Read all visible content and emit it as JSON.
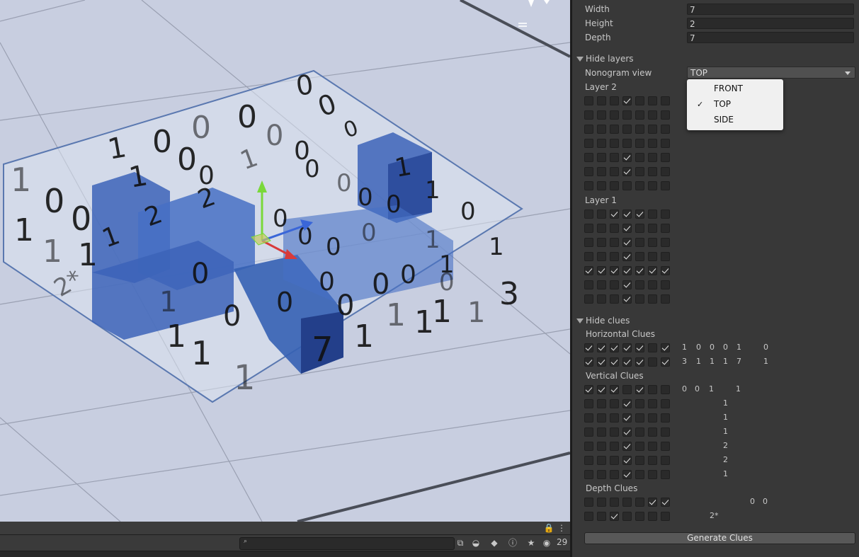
{
  "scene": {
    "numbers": [
      "0",
      "0",
      "0",
      "0",
      "1",
      "0",
      "0",
      "1",
      "0",
      "1",
      "0",
      "0",
      "0",
      "0",
      "0",
      "0",
      "1",
      "0",
      "1",
      "1",
      "1",
      "2",
      "2",
      "2*",
      "1",
      "0",
      "0",
      "1",
      "0",
      "0",
      "0",
      "0",
      "1",
      "0",
      "1",
      "1",
      "1",
      "0",
      "0",
      "1",
      "0",
      "0",
      "0",
      "0",
      "0",
      "0",
      "1",
      "1",
      "3",
      "1",
      "1",
      "1",
      "7",
      "1",
      "1",
      "1"
    ],
    "colors": {
      "sky": "#c9cfe0",
      "cube": "#3c63b8",
      "cube_dark": "#23408a",
      "box_edge": "#5a78b0"
    }
  },
  "inspector": {
    "dims": {
      "width_label": "Width",
      "width_value": "7",
      "height_label": "Height",
      "height_value": "2",
      "depth_label": "Depth",
      "depth_value": "7"
    },
    "hide_layers": {
      "label": "Hide layers",
      "nonogram_view_label": "Nonogram view",
      "nonogram_view_value": "TOP",
      "layer2_label": "Layer 2",
      "layer1_label": "Layer 1",
      "layer2": [
        [
          0,
          0,
          0,
          1,
          0,
          0,
          0
        ],
        [
          0,
          0,
          0,
          0,
          0,
          0,
          0
        ],
        [
          0,
          0,
          0,
          0,
          0,
          0,
          0
        ],
        [
          0,
          0,
          0,
          0,
          0,
          0,
          0
        ],
        [
          0,
          0,
          0,
          1,
          0,
          0,
          0
        ],
        [
          0,
          0,
          0,
          1,
          0,
          0,
          0
        ],
        [
          0,
          0,
          0,
          0,
          0,
          0,
          0
        ]
      ],
      "layer1": [
        [
          0,
          0,
          1,
          1,
          1,
          0,
          0
        ],
        [
          0,
          0,
          0,
          1,
          0,
          0,
          0
        ],
        [
          0,
          0,
          0,
          1,
          0,
          0,
          0
        ],
        [
          0,
          0,
          0,
          1,
          0,
          0,
          0
        ],
        [
          1,
          1,
          1,
          1,
          1,
          1,
          1
        ],
        [
          0,
          0,
          0,
          1,
          0,
          0,
          0
        ],
        [
          0,
          0,
          0,
          1,
          0,
          0,
          0
        ]
      ]
    },
    "hide_clues": {
      "label": "Hide clues",
      "horizontal_label": "Horizontal Clues",
      "vertical_label": "Vertical Clues",
      "depth_label": "Depth Clues",
      "horizontal": [
        {
          "checks": [
            1,
            1,
            1,
            1,
            1,
            0,
            1
          ],
          "values": [
            "1",
            "0",
            "0",
            "0",
            "1",
            "",
            "0"
          ]
        },
        {
          "checks": [
            1,
            1,
            1,
            1,
            1,
            0,
            1
          ],
          "values": [
            "3",
            "1",
            "1",
            "1",
            "7",
            "",
            "1"
          ]
        }
      ],
      "vertical": [
        {
          "checks": [
            1,
            1,
            1,
            0,
            1,
            0,
            0
          ],
          "values": [
            "0",
            "0",
            "1",
            "",
            "1",
            "",
            ""
          ]
        },
        {
          "checks": [
            0,
            0,
            0,
            1,
            0,
            0,
            0
          ],
          "values": [
            "",
            "",
            "",
            "1",
            "",
            "",
            ""
          ]
        },
        {
          "checks": [
            0,
            0,
            0,
            1,
            0,
            0,
            0
          ],
          "values": [
            "",
            "",
            "",
            "1",
            "",
            "",
            ""
          ]
        },
        {
          "checks": [
            0,
            0,
            0,
            1,
            0,
            0,
            0
          ],
          "values": [
            "",
            "",
            "",
            "1",
            "",
            "",
            ""
          ]
        },
        {
          "checks": [
            0,
            0,
            0,
            1,
            0,
            0,
            0
          ],
          "values": [
            "",
            "",
            "",
            "2",
            "",
            "",
            ""
          ]
        },
        {
          "checks": [
            0,
            0,
            0,
            1,
            0,
            0,
            0
          ],
          "values": [
            "",
            "",
            "",
            "2",
            "",
            "",
            ""
          ]
        },
        {
          "checks": [
            0,
            0,
            0,
            1,
            0,
            0,
            0
          ],
          "values": [
            "",
            "",
            "",
            "1",
            "",
            "",
            ""
          ]
        }
      ],
      "depth": [
        {
          "checks": [
            0,
            0,
            0,
            0,
            0,
            1,
            1
          ],
          "values": [
            "",
            "",
            "",
            "",
            "",
            "0",
            "0"
          ]
        },
        {
          "checks": [
            0,
            0,
            1,
            0,
            0,
            0,
            0
          ],
          "values": [
            "",
            "",
            "",
            "2*",
            "",
            "",
            ""
          ]
        }
      ]
    },
    "generate_button": "Generate Clues"
  },
  "dropdown_popup": {
    "options": [
      "FRONT",
      "TOP",
      "SIDE"
    ],
    "selected": "TOP"
  },
  "bottom_bar": {
    "search_placeholder": "",
    "visibility_count": "29"
  }
}
